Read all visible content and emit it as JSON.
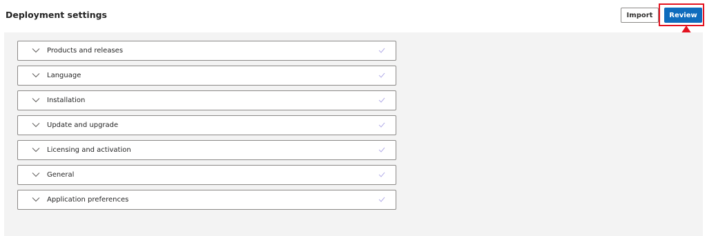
{
  "header": {
    "title": "Deployment settings",
    "import_label": "Import",
    "review_label": "Review"
  },
  "sections": [
    {
      "label": "Products and releases"
    },
    {
      "label": "Language"
    },
    {
      "label": "Installation"
    },
    {
      "label": "Update and upgrade"
    },
    {
      "label": "Licensing and activation"
    },
    {
      "label": "General"
    },
    {
      "label": "Application preferences"
    }
  ],
  "colors": {
    "accent": "#0f6cbd",
    "highlight": "#e3121f",
    "content_bg": "#f3f3f3",
    "check": "#b4aee8"
  },
  "icons": {
    "expand": "chevron-down-icon",
    "status": "checkmark-icon",
    "annotation": "arrow-up-icon"
  }
}
